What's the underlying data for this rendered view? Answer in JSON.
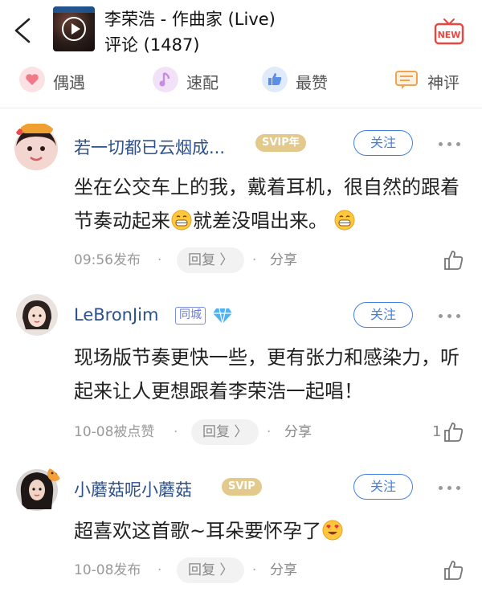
{
  "header": {
    "title": "李荣浩 - 作曲家 (Live)",
    "subtitle": "评论 (1487)",
    "new_badge": "NEW"
  },
  "tabs": [
    {
      "label": "偶遇",
      "icon": "heart-icon",
      "color": "#f07a8a"
    },
    {
      "label": "速配",
      "icon": "music-note-icon",
      "color": "#c98ce0"
    },
    {
      "label": "最赞",
      "icon": "thumbs-up-icon",
      "color": "#5b8ee6"
    },
    {
      "label": "神评",
      "icon": "speech-bubble-icon",
      "color": "#f0a350"
    }
  ],
  "comments": [
    {
      "username": "若一切都已云烟成...",
      "badge": "SVIP年",
      "follow": "关注",
      "content_a": "坐在公交车上的我，戴着耳机，很自然的跟着节奏动起来",
      "content_b": "就差没唱出来。",
      "time": "09:56发布",
      "reply": "回复 〉",
      "share": "分享",
      "likes": ""
    },
    {
      "username": "LeBronJim",
      "badge": "同城",
      "follow": "关注",
      "content_a": "现场版节奏更快一些，更有张力和感染力，听起来让人更想跟着李荣浩一起唱！",
      "time": "10-08被点赞",
      "reply": "回复 〉",
      "share": "分享",
      "likes": "1"
    },
    {
      "username": "小蘑菇呢小蘑菇",
      "badge": "SVIP",
      "follow": "关注",
      "content_a": "超喜欢这首歌~耳朵要怀孕了",
      "time": "10-08发布",
      "reply": "回复 〉",
      "share": "分享",
      "likes": ""
    }
  ],
  "colors": {
    "username": "#2d4f8a",
    "follow": "#3f7fe0",
    "svip_badge": "#e3c98c",
    "new_badge": "#e8473f"
  }
}
